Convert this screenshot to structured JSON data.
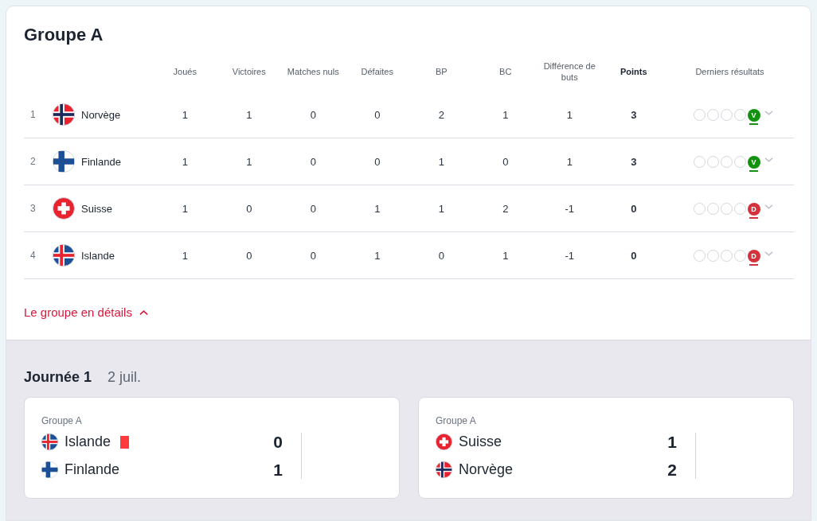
{
  "group": {
    "title": "Groupe A"
  },
  "table": {
    "columns": [
      "Joués",
      "Victoires",
      "Matches nuls",
      "Défaites",
      "BP",
      "BC",
      "Différence de buts",
      "Points",
      "Derniers résultats"
    ],
    "rows": [
      {
        "rank": "1",
        "flag": {
          "kind": "norway"
        },
        "team": "Norvège",
        "stats": [
          "1",
          "1",
          "0",
          "0",
          "2",
          "1",
          "1"
        ],
        "points": "3",
        "results": [
          {
            "kind": "none"
          },
          {
            "kind": "none"
          },
          {
            "kind": "none"
          },
          {
            "kind": "none"
          },
          {
            "kind": "win",
            "label": "V"
          }
        ]
      },
      {
        "rank": "2",
        "flag": {
          "kind": "finland"
        },
        "team": "Finlande",
        "stats": [
          "1",
          "1",
          "0",
          "0",
          "1",
          "0",
          "1"
        ],
        "points": "3",
        "results": [
          {
            "kind": "none"
          },
          {
            "kind": "none"
          },
          {
            "kind": "none"
          },
          {
            "kind": "none"
          },
          {
            "kind": "win",
            "label": "V"
          }
        ]
      },
      {
        "rank": "3",
        "flag": {
          "kind": "switzerland"
        },
        "team": "Suisse",
        "stats": [
          "1",
          "0",
          "0",
          "1",
          "1",
          "2",
          "-1"
        ],
        "points": "0",
        "results": [
          {
            "kind": "none"
          },
          {
            "kind": "none"
          },
          {
            "kind": "none"
          },
          {
            "kind": "none"
          },
          {
            "kind": "loss",
            "label": "D"
          }
        ]
      },
      {
        "rank": "4",
        "flag": {
          "kind": "iceland"
        },
        "team": "Islande",
        "stats": [
          "1",
          "0",
          "0",
          "1",
          "0",
          "1",
          "-1"
        ],
        "points": "0",
        "results": [
          {
            "kind": "none"
          },
          {
            "kind": "none"
          },
          {
            "kind": "none"
          },
          {
            "kind": "none"
          },
          {
            "kind": "loss",
            "label": "D"
          }
        ]
      }
    ]
  },
  "details_link": {
    "label": "Le groupe en détails",
    "expanded": true
  },
  "matchday": {
    "title": "Journée 1",
    "date": "2 juil.",
    "matches": [
      {
        "group": "Groupe A",
        "teams": [
          {
            "flag": {
              "kind": "iceland"
            },
            "name": "Islande",
            "score": "0",
            "red_card": true
          },
          {
            "flag": {
              "kind": "finland"
            },
            "name": "Finlande",
            "score": "1",
            "red_card": false
          }
        ]
      },
      {
        "group": "Groupe A",
        "teams": [
          {
            "flag": {
              "kind": "switzerland"
            },
            "name": "Suisse",
            "score": "1",
            "red_card": false
          },
          {
            "flag": {
              "kind": "norway"
            },
            "name": "Norvège",
            "score": "2",
            "red_card": false
          }
        ]
      }
    ]
  }
}
